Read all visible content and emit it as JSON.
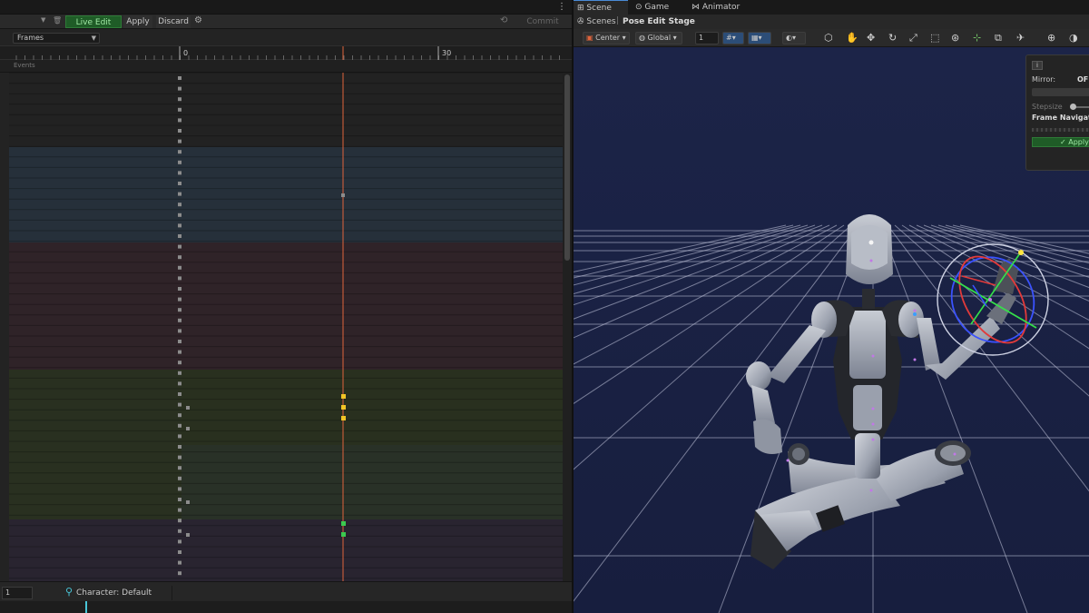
{
  "timeline": {
    "toolbar": {
      "live_edit": "Live Edit",
      "apply": "Apply",
      "discard": "Discard",
      "commit": "Commit"
    },
    "frames_dropdown": "Frames",
    "ruler_labels": [
      "0",
      "30"
    ],
    "events_label": "Events",
    "frame_input": "1",
    "character_label": "Character: Default",
    "ellipsis": "..."
  },
  "scene": {
    "tabs": {
      "scene": "Scene",
      "game": "Game",
      "animator": "Animator"
    },
    "breadcrumb": {
      "scenes": "Scenes",
      "stage": "Pose Edit Stage"
    },
    "toolbar": {
      "pivot": "Center",
      "space": "Global",
      "snap_value": "1"
    },
    "overlay": {
      "mirror_label": "Mirror:",
      "mirror_value": "OF",
      "stepsize_label": "Stepsize",
      "frame_nav_label": "Frame Navigat",
      "apply": "✓ Apply"
    }
  },
  "colors": {
    "live_edit_green": "#1f5c27",
    "cursor_line": "#e0643c",
    "key_yellow": "#f2c526",
    "key_green": "#3bc94f",
    "viewport_bg": "#1a2245",
    "accent_blue": "#4a8bd6"
  }
}
